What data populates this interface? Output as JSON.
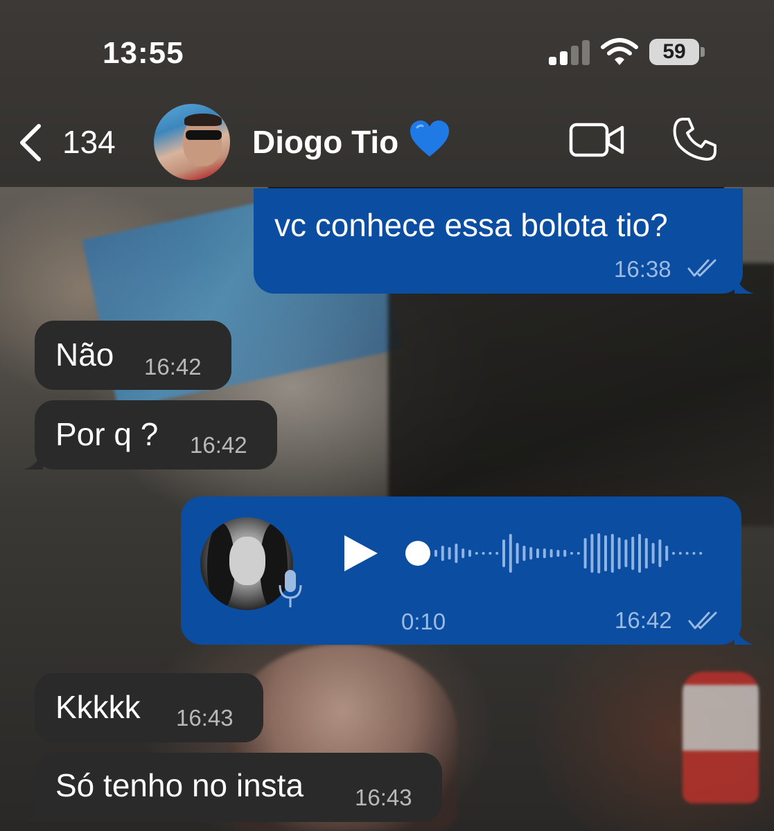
{
  "status_bar": {
    "time": "13:55",
    "battery": "59"
  },
  "header": {
    "back_count": "134",
    "contact_name": "Diogo Tio",
    "heart_color": "#1f7ae6"
  },
  "messages": [
    {
      "direction": "outgoing",
      "text": "vc conhece essa bolota tio?",
      "time": "16:38",
      "read": true
    },
    {
      "direction": "incoming",
      "text": "Não",
      "time": "16:42"
    },
    {
      "direction": "incoming",
      "text": "Por q ?",
      "time": "16:42"
    },
    {
      "direction": "outgoing",
      "type": "voice",
      "duration": "0:10",
      "time": "16:42",
      "read": true,
      "progress": 0
    },
    {
      "direction": "incoming",
      "text": "Kkkkk",
      "time": "16:43"
    },
    {
      "direction": "incoming",
      "text": "Só tenho no insta",
      "time": "16:43"
    }
  ],
  "colors": {
    "outgoing_bubble": "#0a4da1",
    "incoming_bubble": "#2a2a2a",
    "header_bg": "#3a3734"
  },
  "icons": [
    "back-chevron-icon",
    "video-call-icon",
    "phone-call-icon",
    "play-icon",
    "microphone-icon",
    "double-check-icon",
    "blue-heart-icon"
  ]
}
